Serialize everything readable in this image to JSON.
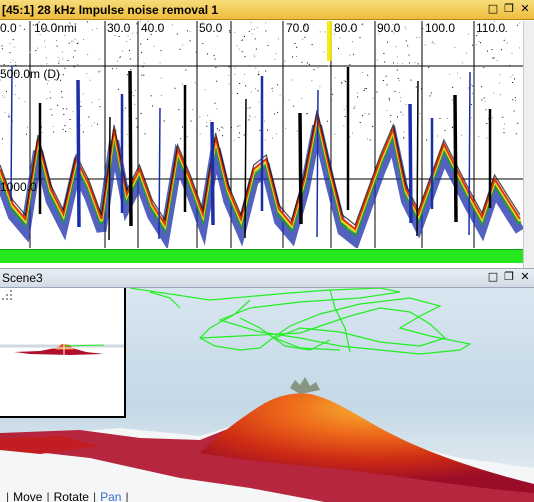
{
  "echogram": {
    "title": "[45:1] 28 kHz Impulse noise removal 1",
    "x_tick_labels": [
      "0.0",
      "10.0nmi",
      "30.0",
      "40.0",
      "50.0",
      "70.0",
      "80.0",
      "90.0",
      "100.0",
      "110.0"
    ],
    "depth_labels": [
      "500.0m (D)",
      "1000.0"
    ],
    "window_buttons": {
      "minimize": "□",
      "restore": "❐",
      "close": "✕"
    },
    "colors": {
      "title_bar": "#f0c040",
      "bottom_line": "#27e81f",
      "echo_blue": "#1a2ea8",
      "echo_red": "#e02010",
      "echo_yellow": "#f5e60a"
    }
  },
  "scene": {
    "title": "Scene3",
    "window_buttons": {
      "minimize": "□",
      "restore": "❐",
      "close": "✕"
    },
    "nav": {
      "move": "Move",
      "rotate": "Rotate",
      "pan": "Pan"
    },
    "colors": {
      "track": "#22ee22",
      "sky": "#c8dbe8",
      "terrain_peak": "#f5a623",
      "terrain_base": "#b0102a",
      "pan_active": "#3a6fc7"
    }
  }
}
